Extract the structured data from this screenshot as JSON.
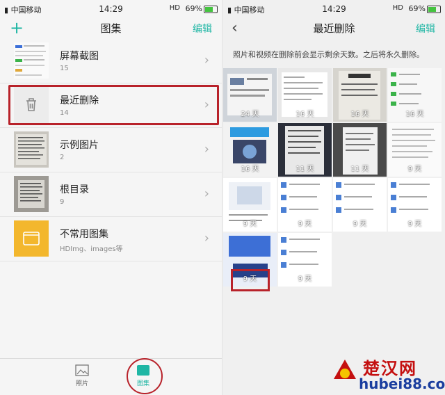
{
  "left": {
    "status": {
      "carrier": "中国移动",
      "time": "14:29",
      "hd": "HD",
      "battery": "69%"
    },
    "title": "图集",
    "add_icon": "plus-icon",
    "edit": "编辑",
    "albums": [
      {
        "name": "屏幕截图",
        "count": "15"
      },
      {
        "name": "最近删除",
        "count": "14",
        "icon": "trash-icon"
      },
      {
        "name": "示例图片",
        "count": "2"
      },
      {
        "name": "根目录",
        "count": "9"
      },
      {
        "name": "不常用图集",
        "count": "HDImg、images等",
        "icon": "folder-icon"
      }
    ],
    "tabs": [
      {
        "label": "照片",
        "icon": "image-icon"
      },
      {
        "label": "图集",
        "icon": "album-icon"
      }
    ]
  },
  "right": {
    "status": {
      "carrier": "中国移动",
      "time": "14:29",
      "hd": "HD",
      "battery": "69%"
    },
    "title": "最近删除",
    "back_icon": "back-chevron-icon",
    "edit": "编辑",
    "info": "照片和视频在删除前会显示剩余天数。之后将永久删除。",
    "photos": [
      {
        "days": "24 天"
      },
      {
        "days": "16 天"
      },
      {
        "days": "16 天"
      },
      {
        "days": "16 天"
      },
      {
        "days": "16 天"
      },
      {
        "days": "11 天"
      },
      {
        "days": "11 天"
      },
      {
        "days": "9 天"
      },
      {
        "days": "9 天"
      },
      {
        "days": "9 天"
      },
      {
        "days": "9 天"
      },
      {
        "days": "9 天"
      },
      {
        "days": "9 天"
      },
      {
        "days": "9 天"
      }
    ]
  },
  "watermark": {
    "brand": "楚汉网",
    "url": "hubei88.com"
  }
}
